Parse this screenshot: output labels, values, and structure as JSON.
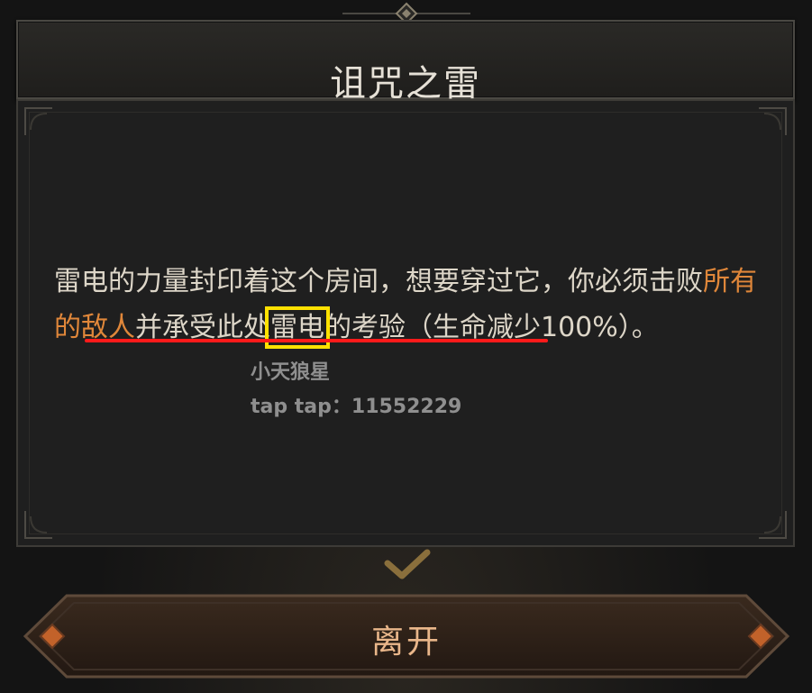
{
  "dialog": {
    "title": "诅咒之雷",
    "description": {
      "part1": "雷电的力量封印着这个房间，想要穿过它，你必须击败",
      "highlight": "所有的敌人",
      "part2": "并承受此处",
      "boxed": "雷电",
      "part3": "的考验（生命减少100%）。"
    },
    "colors": {
      "highlight": "#e0873a",
      "underline": "#ff1a1a",
      "box": "#ffe100"
    }
  },
  "watermark": {
    "line1": "小天狼星",
    "line2": "tap tap：11552229"
  },
  "confirm_icon": "checkmark-icon",
  "leave_button": {
    "label": "离开"
  }
}
